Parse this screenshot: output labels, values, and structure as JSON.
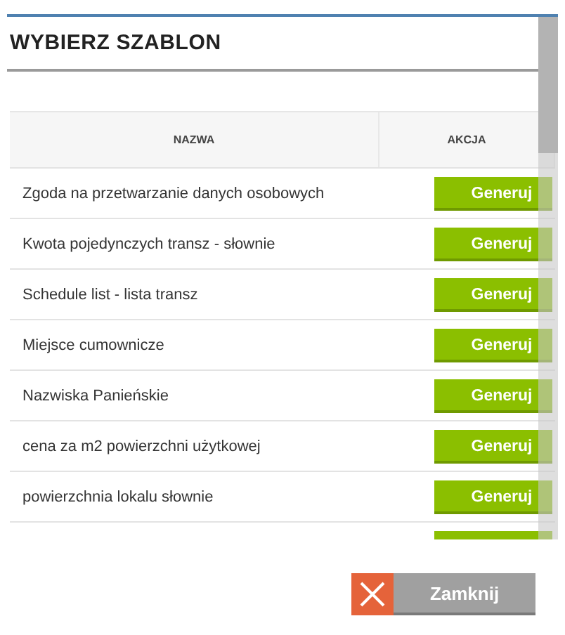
{
  "dialog": {
    "title": "WYBIERZ SZABLON"
  },
  "table": {
    "columns": [
      "NAZWA",
      "AKCJA"
    ],
    "rows": [
      {
        "kind": "template",
        "name": "Zgoda na przetwarzanie danych osobowych",
        "action": "Generuj"
      },
      {
        "kind": "template",
        "name": "Kwota pojedynczych transz - słownie",
        "action": "Generuj"
      },
      {
        "kind": "template",
        "name": "Schedule list - lista transz",
        "action": "Generuj"
      },
      {
        "kind": "template",
        "name": "Miejsce cumownicze",
        "action": "Generuj"
      },
      {
        "kind": "template",
        "name": "Nazwiska Panieńskie",
        "action": "Generuj"
      },
      {
        "kind": "template",
        "name": "cena za m2 powierzchni użytkowej",
        "action": "Generuj"
      },
      {
        "kind": "template",
        "name": "powierzchnia lokalu słownie",
        "action": "Generuj"
      },
      {
        "kind": "partial"
      }
    ]
  },
  "footer": {
    "close_button": "Zamknij"
  }
}
